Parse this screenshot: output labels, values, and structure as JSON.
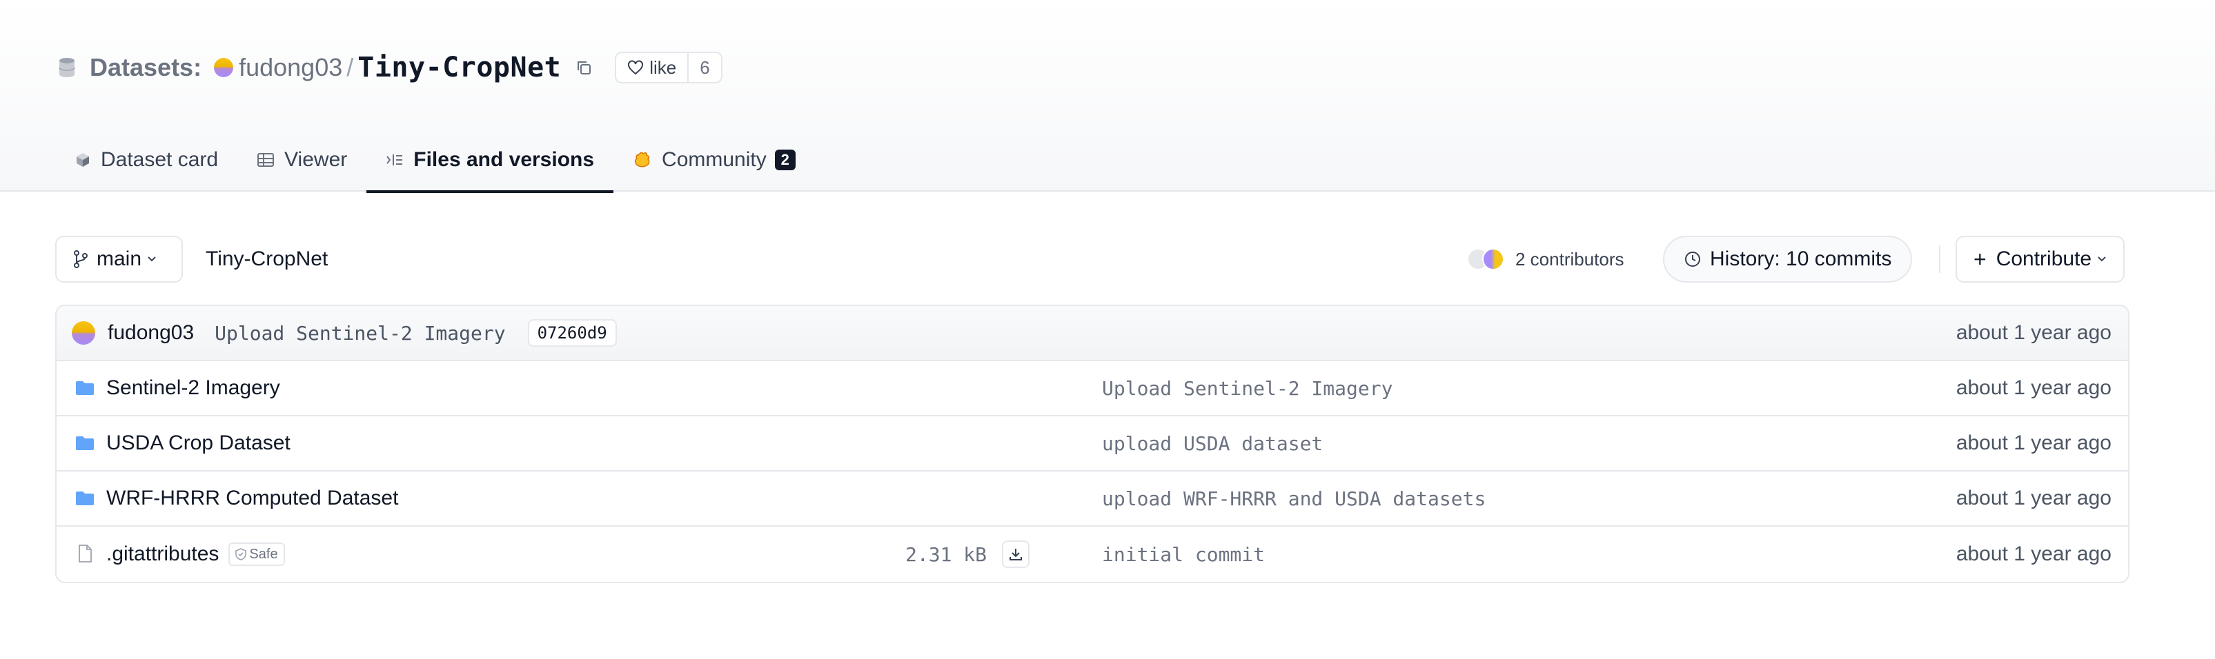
{
  "header": {
    "section_label": "Datasets:",
    "org": "fudong03",
    "separator": "/",
    "repo": "Tiny-CropNet",
    "like_label": "like",
    "like_count": "6"
  },
  "tabs": [
    {
      "label": "Dataset card",
      "icon": "cube-icon"
    },
    {
      "label": "Viewer",
      "icon": "table-icon"
    },
    {
      "label": "Files and versions",
      "icon": "files-icon",
      "active": true
    },
    {
      "label": "Community",
      "icon": "hf-hand-icon",
      "badge": "2"
    }
  ],
  "toolbar": {
    "branch": "main",
    "path": "Tiny-CropNet",
    "contributors": "2 contributors",
    "history": "History: 10 commits",
    "contribute": "Contribute"
  },
  "last_commit": {
    "author": "fudong03",
    "message": "Upload Sentinel-2 Imagery",
    "hash": "07260d9",
    "time": "about 1 year ago"
  },
  "files": [
    {
      "name": "Sentinel-2 Imagery",
      "type": "folder",
      "size": "",
      "message": "Upload Sentinel-2 Imagery",
      "time": "about 1 year ago"
    },
    {
      "name": "USDA Crop Dataset",
      "type": "folder",
      "size": "",
      "message": "upload USDA dataset",
      "time": "about 1 year ago"
    },
    {
      "name": "WRF-HRRR Computed Dataset",
      "type": "folder",
      "size": "",
      "message": "upload WRF-HRRR and USDA datasets",
      "time": "about 1 year ago"
    },
    {
      "name": ".gitattributes",
      "type": "file",
      "safe_label": "Safe",
      "size": "2.31 kB",
      "message": "initial commit",
      "time": "about 1 year ago"
    }
  ],
  "colors": {
    "folder": "#60a5fa",
    "accent_dark": "#111827",
    "muted": "#6b7280",
    "border": "#e5e7eb"
  }
}
